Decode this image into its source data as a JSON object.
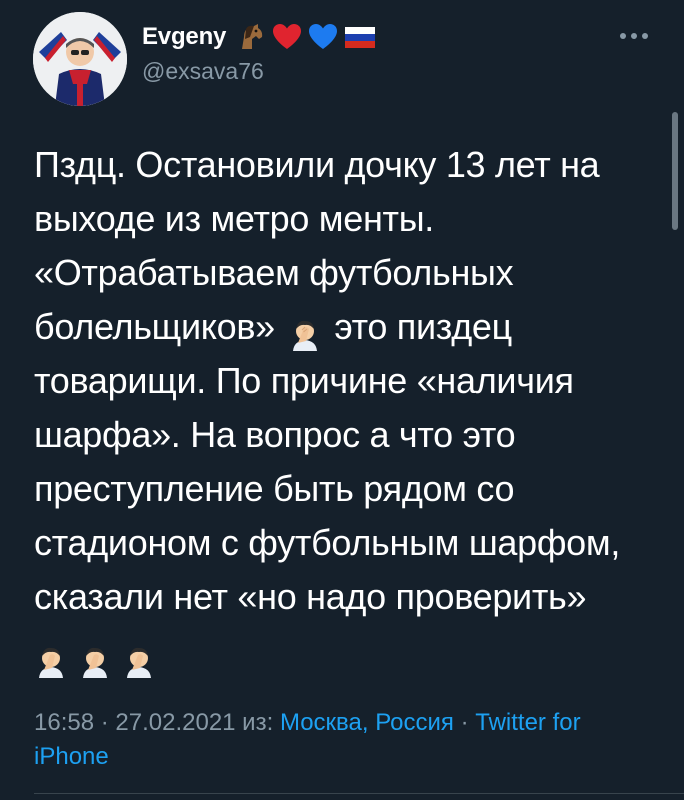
{
  "author": {
    "name": "Evgeny",
    "handle": "@exsava76",
    "name_emojis": [
      "horse-icon",
      "red-heart-icon",
      "blue-heart-icon",
      "russia-flag-icon"
    ]
  },
  "tweet": {
    "text_before_emoji": "Пздц. Остановили дочку 13 лет на выходе из метро менты. «Отрабатываем футбольных болельщиков»",
    "text_after_emoji": "это пиздец товарищи. По причине «наличия шарфа». На вопрос а что это преступление быть рядом со стадионом с футбольным шарфом, сказали нет «но надо проверить»",
    "inline_emoji": "facepalm-icon",
    "trailing_emojis": [
      "facepalm-icon",
      "facepalm-icon",
      "facepalm-icon"
    ]
  },
  "meta": {
    "time": "16:58",
    "separator": " · ",
    "date": "27.02.2021",
    "from_label": " из: ",
    "location": "Москва, Россия",
    "client": "Twitter for iPhone"
  },
  "colors": {
    "background": "#15202b",
    "text": "#ffffff",
    "secondary": "#8899a6",
    "link": "#1da1f2"
  }
}
